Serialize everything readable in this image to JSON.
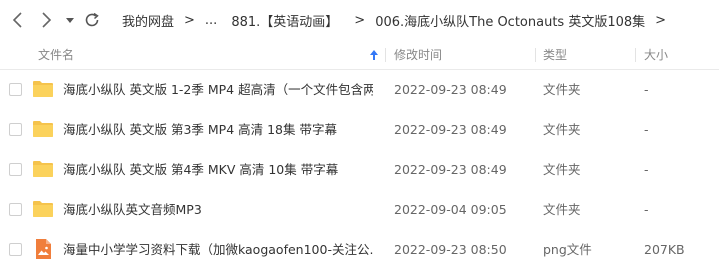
{
  "breadcrumb": {
    "root": "我的网盘",
    "ellipsis": "...",
    "parent": "881.【英语动画】",
    "current": "006.海底小纵队The Octonauts 英文版108集"
  },
  "columns": {
    "name": "文件名",
    "modified": "修改时间",
    "type": "类型",
    "size": "大小"
  },
  "files": [
    {
      "name": "海底小纵队 英文版 1-2季 MP4 超高清（一个文件包含两...",
      "modified": "2022-09-23 08:49",
      "type": "文件夹",
      "size": "-",
      "icon": "folder-icon"
    },
    {
      "name": "海底小纵队 英文版 第3季 MP4 高清 18集 带字幕",
      "modified": "2022-09-23 08:49",
      "type": "文件夹",
      "size": "-",
      "icon": "folder-icon"
    },
    {
      "name": "海底小纵队 英文版 第4季 MKV 高清 10集 带字幕",
      "modified": "2022-09-23 08:49",
      "type": "文件夹",
      "size": "-",
      "icon": "folder-icon"
    },
    {
      "name": "海底小纵队英文音频MP3",
      "modified": "2022-09-04 09:05",
      "type": "文件夹",
      "size": "-",
      "icon": "folder-icon"
    },
    {
      "name": "海量中小学学习资料下载（加微kaogaofen100-关注公...",
      "modified": "2022-09-23 08:50",
      "type": "png文件",
      "size": "207KB",
      "icon": "image-file-icon"
    }
  ],
  "colors": {
    "folder": "#f5c34c",
    "image_file": "#f07e3c",
    "accent": "#3478f6"
  }
}
